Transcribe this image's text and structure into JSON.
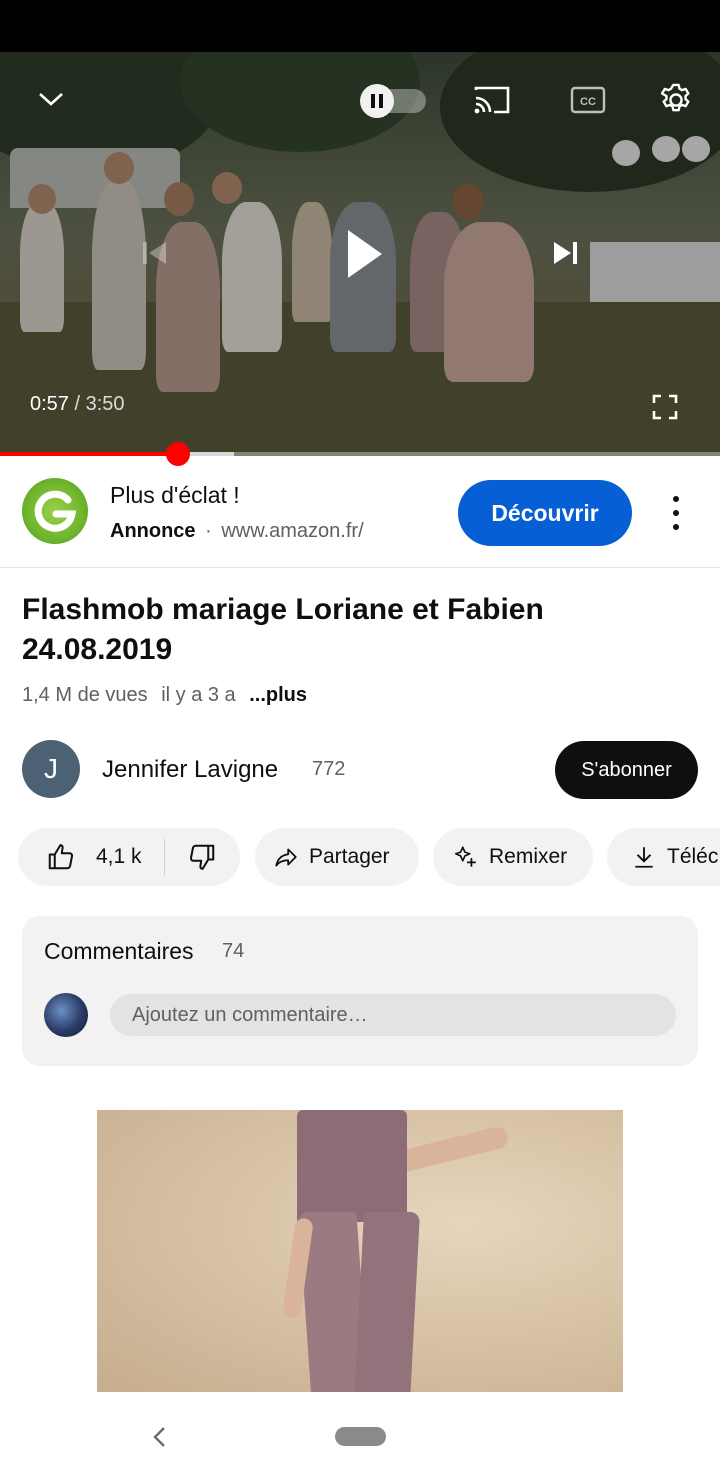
{
  "player": {
    "time_current": "0:57",
    "time_separator": " / ",
    "time_total": "3:50",
    "progress": 0.247,
    "buffered": 0.325,
    "progress_color": "#ff0000",
    "icons": [
      "chevron-down-icon",
      "autoplay-toggle",
      "cast-icon",
      "closed-captions-icon",
      "gear-icon",
      "previous-icon",
      "play-icon",
      "next-icon",
      "fullscreen-icon"
    ]
  },
  "ad": {
    "title": "Plus d'éclat !",
    "label": "Annonce",
    "separator": "·",
    "domain": "www.amazon.fr/",
    "cta": "Découvrir",
    "cta_color": "#065fd4"
  },
  "video": {
    "title": "Flashmob mariage Loriane et Fabien 24.08.2019",
    "views": "1,4 M de vues",
    "age": "il y a 3 a",
    "more": "...plus"
  },
  "channel": {
    "avatar_letter": "J",
    "name": "Jennifer Lavigne",
    "subscribers": "772",
    "subscribe_label": "S'abonner"
  },
  "actions": {
    "likes": "4,1 k",
    "share": "Partager",
    "remix": "Remixer",
    "download": "Téléc"
  },
  "comments": {
    "title": "Commentaires",
    "count": "74",
    "placeholder": "Ajoutez un commentaire…"
  }
}
